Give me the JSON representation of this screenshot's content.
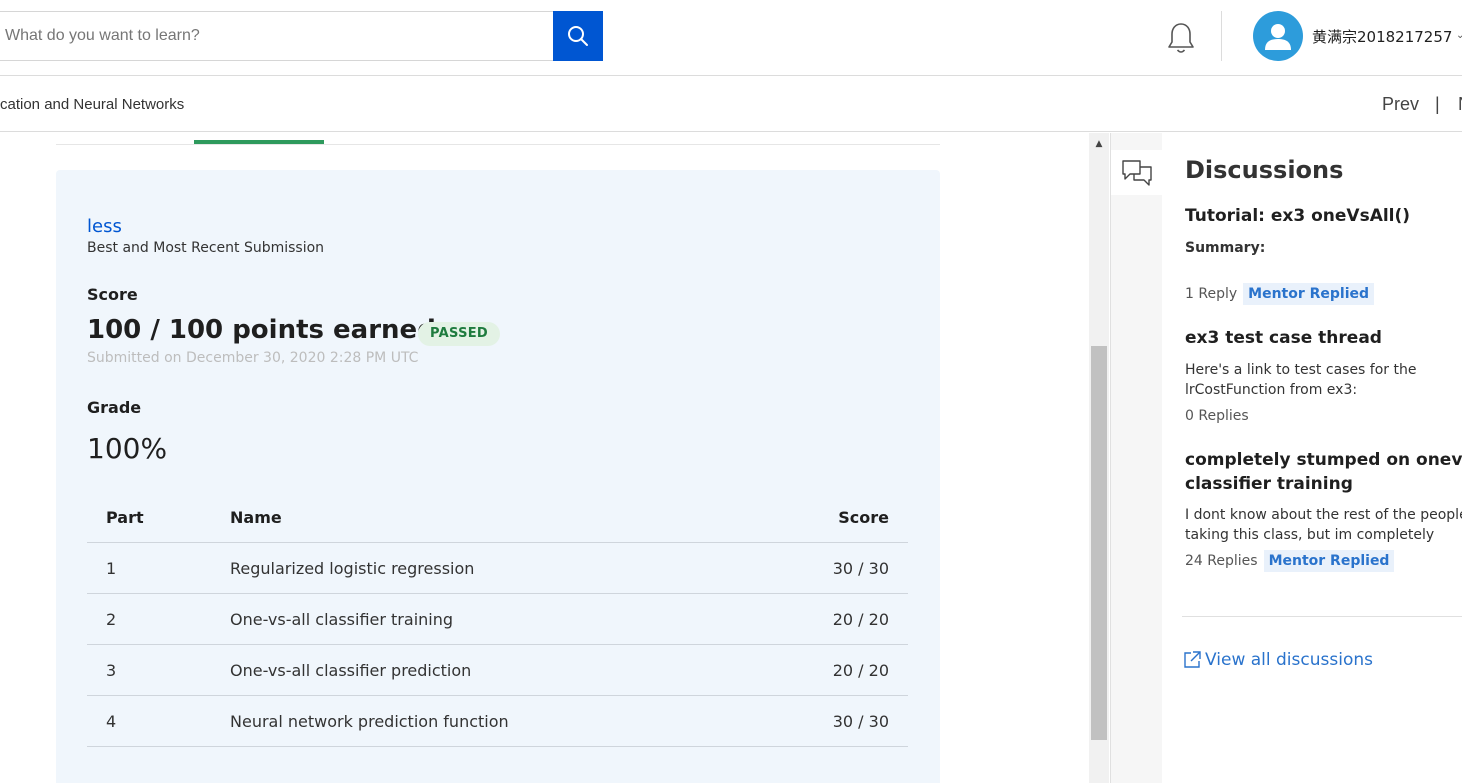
{
  "header": {
    "search_placeholder": "What do you want to learn?",
    "username": "黄满宗2018217257"
  },
  "subheader": {
    "course_title": "cation and Neural Networks",
    "prev_label": "Prev",
    "separator": "|",
    "next_label": "Next"
  },
  "submission": {
    "toggle_label": "less",
    "subtitle": "Best and Most Recent Submission",
    "score_heading": "Score",
    "points_text": "100 / 100 points earned",
    "status_badge": "PASSED",
    "submitted_text": "Submitted on December 30, 2020 2:28 PM UTC",
    "grade_heading": "Grade",
    "grade_value": "100%"
  },
  "parts_table": {
    "headers": {
      "part": "Part",
      "name": "Name",
      "score": "Score"
    },
    "rows": [
      {
        "part": "1",
        "name": "Regularized logistic regression",
        "score": "30 / 30"
      },
      {
        "part": "2",
        "name": "One-vs-all classifier training",
        "score": "20 / 20"
      },
      {
        "part": "3",
        "name": "One-vs-all classifier prediction",
        "score": "20 / 20"
      },
      {
        "part": "4",
        "name": "Neural network prediction function",
        "score": "30 / 30"
      }
    ]
  },
  "discussions": {
    "title": "Discussions",
    "items": [
      {
        "title": "Tutorial: ex3 oneVsAll()",
        "summary_label": "Summary:",
        "replies": "1 Reply",
        "badge": "Mentor Replied"
      },
      {
        "title": "ex3 test case thread",
        "body_line1": "Here's a link to test cases for the",
        "body_line2": "lrCostFunction from ex3:",
        "replies": "0 Replies"
      },
      {
        "title_line1": "completely stumped on onevsall",
        "title_line2": "classifier training",
        "body_line1": "I dont know about the rest of the people",
        "body_line2": "taking this class, but im completely",
        "replies": "24 Replies",
        "badge": "Mentor Replied"
      }
    ],
    "view_all_label": "View all discussions"
  },
  "colors": {
    "primary_blue": "#0056d2",
    "passed_green": "#1e7b3e",
    "tab_indicator": "#2e9a5d",
    "card_bg": "#f0f6fc",
    "link_blue": "#2a73cc"
  }
}
